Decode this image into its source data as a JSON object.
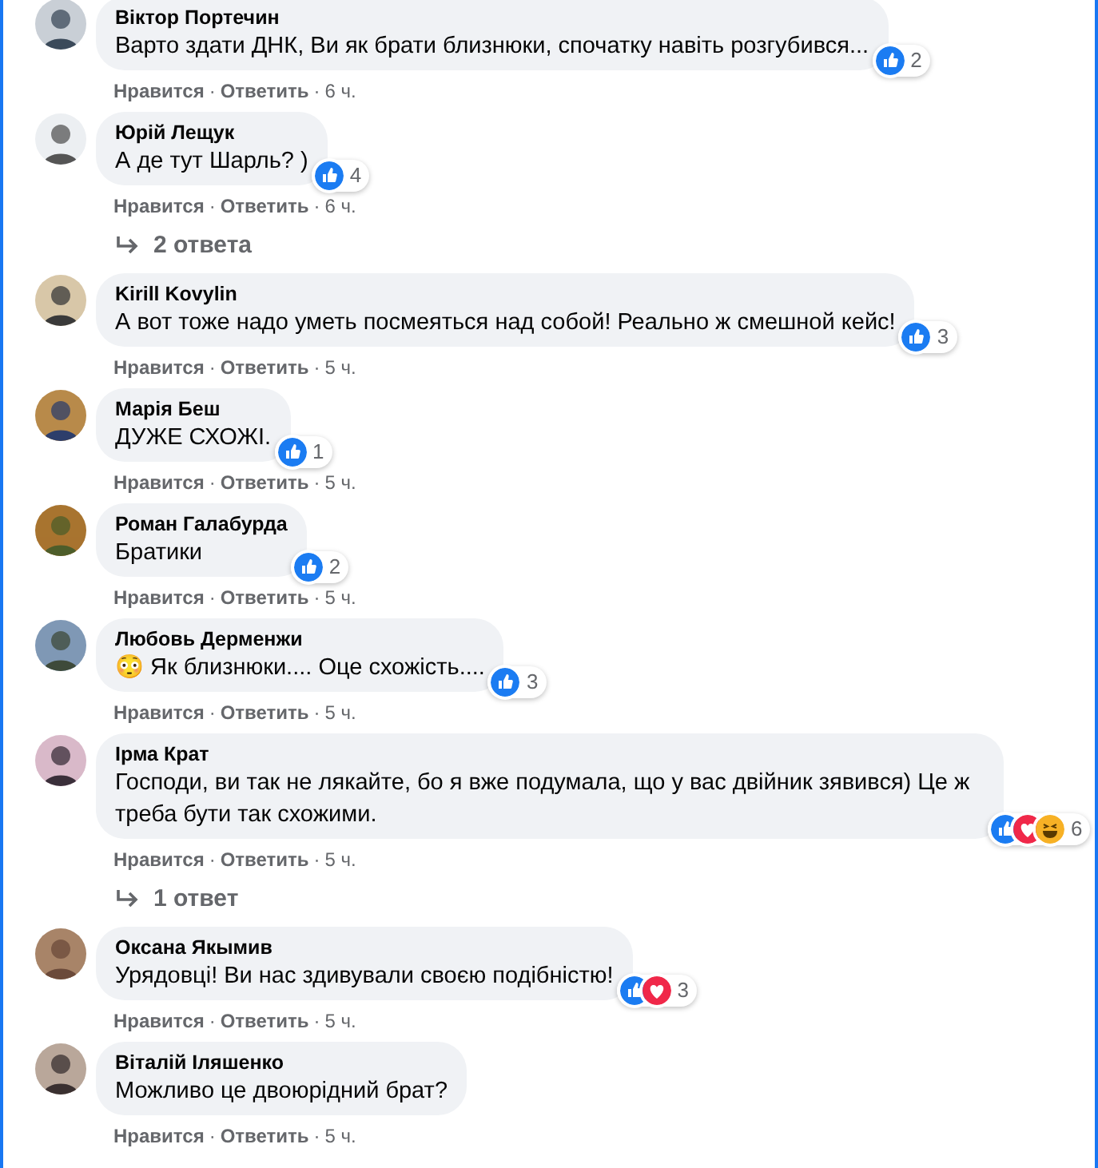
{
  "thread": [
    {
      "kind": "comment",
      "author": "Віктор Портечин",
      "text": "Варто здати ДНК, Ви як брати близнюки, спочатку навіть розгубився...",
      "reactions": [
        {
          "kind": "like"
        }
      ],
      "reaction_count": "2",
      "like": "Нравится",
      "separator": "·",
      "reply": "Ответить",
      "separator_2": "·",
      "time": "6 ч."
    },
    {
      "kind": "comment",
      "author": "Юрій Лещук",
      "text": "А де тут Шарль? )",
      "reactions": [
        {
          "kind": "like"
        }
      ],
      "reaction_count": "4",
      "like": "Нравится",
      "separator": "·",
      "reply": "Ответить",
      "separator_2": "·",
      "time": "6 ч."
    },
    {
      "kind": "replies",
      "label": "2 ответа"
    },
    {
      "kind": "comment",
      "author": "Kirill Kovylin",
      "text": "А вот тоже надо уметь посмеяться над собой! Реально ж смешной кейс!",
      "reactions": [
        {
          "kind": "like"
        }
      ],
      "reaction_count": "3",
      "like": "Нравится",
      "separator": "·",
      "reply": "Ответить",
      "separator_2": "·",
      "time": "5 ч."
    },
    {
      "kind": "comment",
      "author": "Марія Беш",
      "text": "ДУЖЕ СХОЖІ.",
      "reactions": [
        {
          "kind": "like"
        }
      ],
      "reaction_count": "1",
      "like": "Нравится",
      "separator": "·",
      "reply": "Ответить",
      "separator_2": "·",
      "time": "5 ч."
    },
    {
      "kind": "comment",
      "author": "Роман Галабурда",
      "text": "Братики",
      "reactions": [
        {
          "kind": "like"
        }
      ],
      "reaction_count": "2",
      "like": "Нравится",
      "separator": "·",
      "reply": "Ответить",
      "separator_2": "·",
      "time": "5 ч."
    },
    {
      "kind": "comment",
      "author": "Любовь Дерменжи",
      "text": "😳 Як близнюки.... Оце схожість....",
      "reactions": [
        {
          "kind": "like"
        }
      ],
      "reaction_count": "3",
      "like": "Нравится",
      "separator": "·",
      "reply": "Ответить",
      "separator_2": "·",
      "time": "5 ч."
    },
    {
      "kind": "comment",
      "author": "Ірма Крат",
      "text": "Господи, ви так не лякайте, бо я вже подумала, що у вас двійник зявився) Це ж треба бути так схожими.",
      "reactions": [
        {
          "kind": "like"
        },
        {
          "kind": "love"
        },
        {
          "kind": "haha"
        }
      ],
      "reaction_count": "6",
      "like": "Нравится",
      "separator": "·",
      "reply": "Ответить",
      "separator_2": "·",
      "time": "5 ч."
    },
    {
      "kind": "replies",
      "label": "1 ответ"
    },
    {
      "kind": "comment",
      "author": "Оксана Якымив",
      "text": "Урядовці! Ви нас здивували своєю подібністю!",
      "reactions": [
        {
          "kind": "like"
        },
        {
          "kind": "love"
        }
      ],
      "reaction_count": "3",
      "like": "Нравится",
      "separator": "·",
      "reply": "Ответить",
      "separator_2": "·",
      "time": "5 ч."
    },
    {
      "kind": "comment",
      "author": "Віталій Іляшенко",
      "text": "Можливо це двоюрідний брат?",
      "like": "Нравится",
      "separator": "·",
      "reply": "Ответить",
      "separator_2": "·",
      "time": "5 ч."
    }
  ]
}
